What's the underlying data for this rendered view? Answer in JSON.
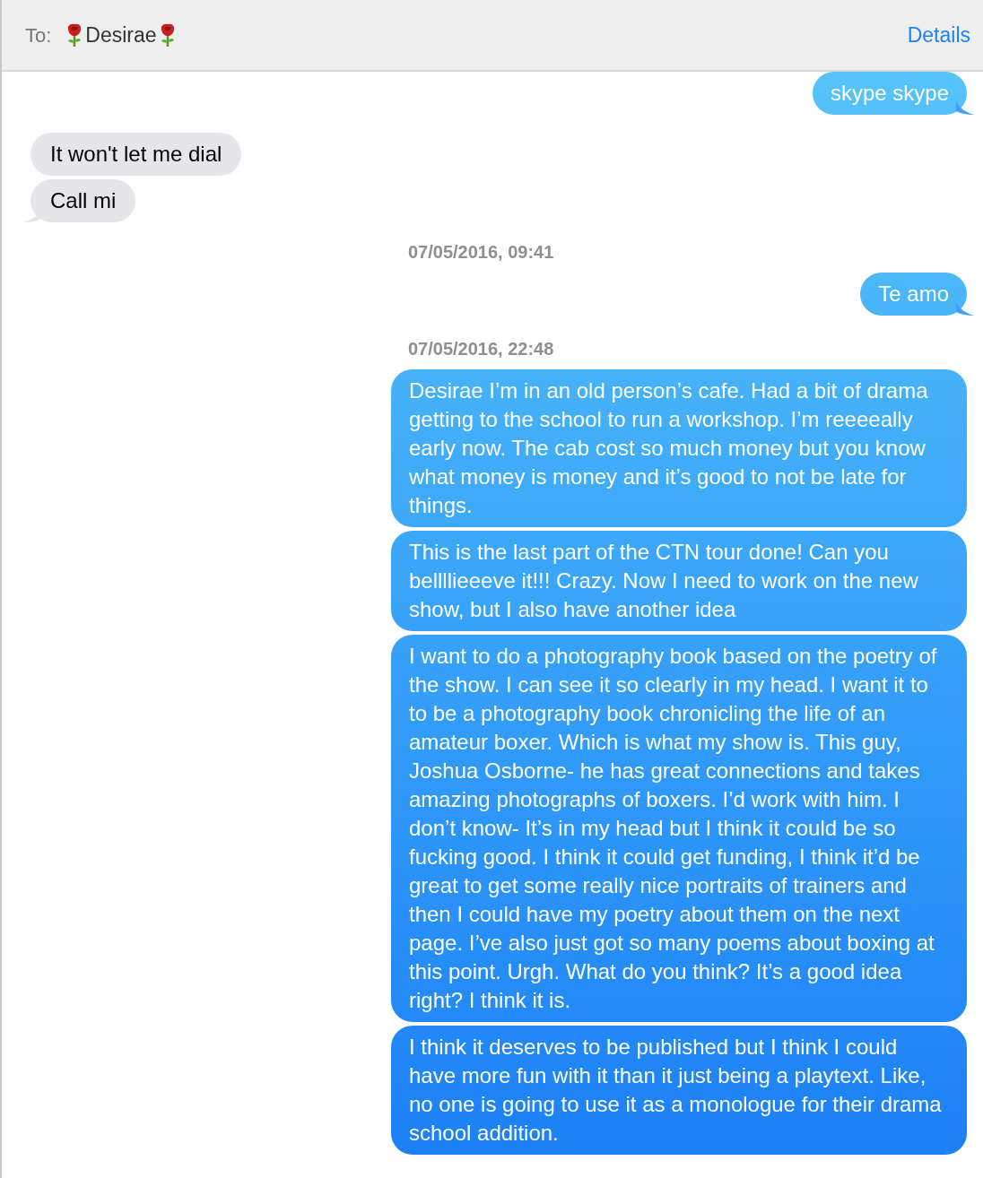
{
  "header": {
    "to_label": "To:",
    "recipient": "Desirae",
    "details": "Details"
  },
  "messages": [
    {
      "kind": "sent",
      "text": "skype skype",
      "tail": true
    },
    {
      "kind": "received",
      "text": "It won't let me dial",
      "tail": false
    },
    {
      "kind": "received",
      "text": "Call mi",
      "tail": true
    },
    {
      "kind": "timestamp",
      "text": "07/05/2016, 09:41"
    },
    {
      "kind": "sent",
      "text": "Te amo",
      "tail": true
    },
    {
      "kind": "timestamp",
      "text": "07/05/2016, 22:48"
    },
    {
      "kind": "sent",
      "text": "Desirae I’m in an old person’s cafe. Had a bit of drama getting to the school to run a workshop. I’m reeeeally early now. The cab cost so much money but you know what money is money and it’s good to not be late for things.",
      "tail": false
    },
    {
      "kind": "sent",
      "text": "This is the last part of the CTN tour done! Can you bellllieeeve it!!! Crazy. Now I need to work on the new show, but I also have another idea",
      "tail": false
    },
    {
      "kind": "sent",
      "text": "I want to do a photography book based on the poetry of the show. I can see it so clearly in my head. I want it to to be a photography book chronicling the life of an amateur boxer. Which is what my show is. This guy, Joshua Osborne- he has great connections and takes amazing photographs of boxers. I’d work with him. I don’t know- It’s in my head but I think it could be so fucking good. I think it could get funding, I think it’d be great to get some really nice portraits of trainers and then I could have my poetry about them on the next page. I’ve also just got so many poems about boxing at this point. Urgh. What do you think? It’s a good idea right? I think it is.",
      "tail": false
    },
    {
      "kind": "sent",
      "text": "I think it deserves to be published but I think I could have more fun with it than it just being a playtext. Like, no one is going to use it as a monologue for their drama school addition.",
      "tail": false
    }
  ]
}
